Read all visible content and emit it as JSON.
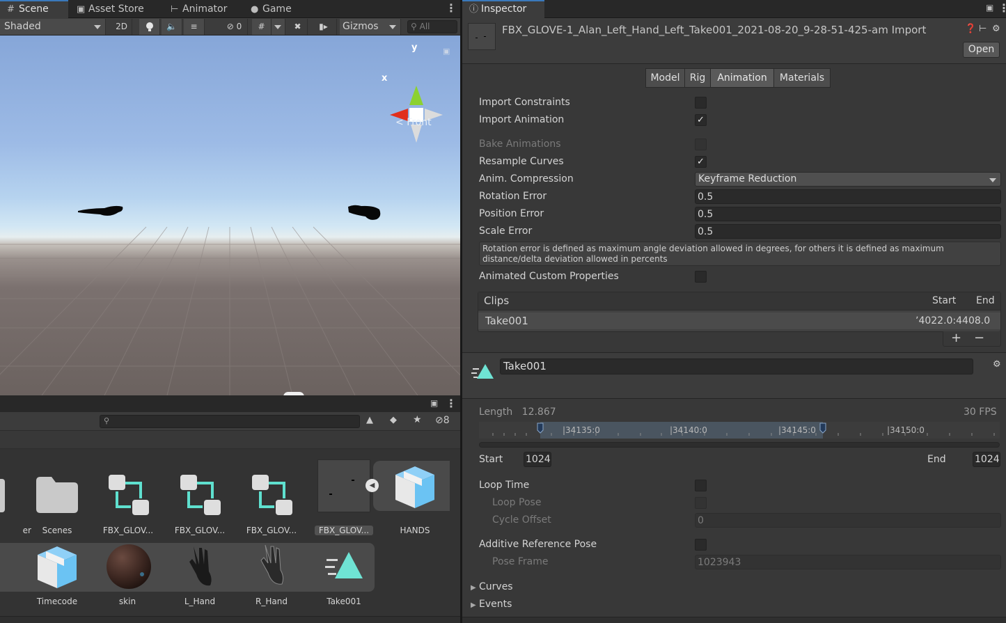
{
  "tabs_left": [
    {
      "label": "Scene",
      "icon": "grid-icon"
    },
    {
      "label": "Asset Store",
      "icon": "store-bag-icon"
    },
    {
      "label": "Animator",
      "icon": "animator-icon"
    },
    {
      "label": "Game",
      "icon": "gamepad-icon"
    }
  ],
  "scene_toolbar": {
    "draw_mode": "Shaded",
    "mode_2d": "2D",
    "hidden_count": "0",
    "gizmos": "Gizmos",
    "search_placeholder": "All"
  },
  "gizmo": {
    "x_label": "x",
    "y_label": "y",
    "view_label": "Front"
  },
  "project": {
    "hidden_count": "8",
    "assets_row1": [
      {
        "label": "er",
        "icon": "folder-icon"
      },
      {
        "label": "Scenes",
        "icon": "folder-icon"
      },
      {
        "label": "FBX_GLOV...",
        "icon": "prefab-variant-icon"
      },
      {
        "label": "FBX_GLOV...",
        "icon": "prefab-variant-icon"
      },
      {
        "label": "FBX_GLOV...",
        "icon": "prefab-variant-icon"
      },
      {
        "label": "FBX_GLOV...",
        "icon": "model-thumbnail"
      },
      {
        "label": "HANDS",
        "icon": "model-prefab-icon"
      }
    ],
    "assets_row2": [
      {
        "label": "Timecode",
        "icon": "model-prefab-icon"
      },
      {
        "label": "skin",
        "icon": "material-sphere-icon"
      },
      {
        "label": "L_Hand",
        "icon": "hand-mesh-icon"
      },
      {
        "label": "R_Hand",
        "icon": "hand-mesh-icon"
      },
      {
        "label": "Take001",
        "icon": "animation-clip-icon"
      }
    ]
  },
  "inspector": {
    "tab_label": "Inspector",
    "title": "FBX_GLOVE-1_Alan_Left_Hand_Left_Take001_2021-08-20_9-28-51-425-am Import",
    "open_label": "Open",
    "import_tabs": [
      "Model",
      "Rig",
      "Animation",
      "Materials"
    ],
    "active_import_tab": "Animation",
    "import_constraints": {
      "label": "Import Constraints",
      "checked": false
    },
    "import_animation": {
      "label": "Import Animation",
      "checked": true,
      "mark": "✓"
    },
    "bake_animations": {
      "label": "Bake Animations",
      "checked": false
    },
    "resample_curves": {
      "label": "Resample Curves",
      "checked": true,
      "mark": "✓"
    },
    "anim_compression": {
      "label": "Anim. Compression",
      "value": "Keyframe Reduction"
    },
    "rotation_error": {
      "label": "Rotation Error",
      "value": "0.5"
    },
    "position_error": {
      "label": "Position Error",
      "value": "0.5"
    },
    "scale_error": {
      "label": "Scale Error",
      "value": "0.5"
    },
    "help_text": "Rotation error is defined as maximum angle deviation allowed in degrees, for others it is defined as maximum distance/delta deviation allowed in percents",
    "animated_custom_properties": {
      "label": "Animated Custom Properties",
      "checked": false
    },
    "clips": {
      "header": "Clips",
      "col_start": "Start",
      "col_end": "End",
      "rows": [
        {
          "name": "Take001",
          "range": "ʼ4022.0:4408.0"
        }
      ],
      "add": "+",
      "remove": "−"
    },
    "clip": {
      "name": "Take001",
      "length_label": "Length",
      "length_value": "12.867",
      "fps": "30 FPS",
      "timeline_ticks": [
        "|34135:0",
        "|34140:0",
        "|34145:0",
        "|34150:0"
      ],
      "start_label": "Start",
      "start_value": "1024",
      "end_label": "End",
      "end_value": "1024",
      "loop_time": {
        "label": "Loop Time",
        "checked": false
      },
      "loop_pose": {
        "label": "Loop Pose",
        "checked": false
      },
      "cycle_offset": {
        "label": "Cycle Offset",
        "value": "0"
      },
      "additive_ref_pose": {
        "label": "Additive Reference Pose",
        "checked": false
      },
      "pose_frame": {
        "label": "Pose Frame",
        "value": "1023943"
      },
      "curves": "Curves",
      "events": "Events"
    }
  },
  "colors": {
    "accent": "#3a79bb",
    "panel": "#383838",
    "clip_icon": "#6fe3d4"
  }
}
